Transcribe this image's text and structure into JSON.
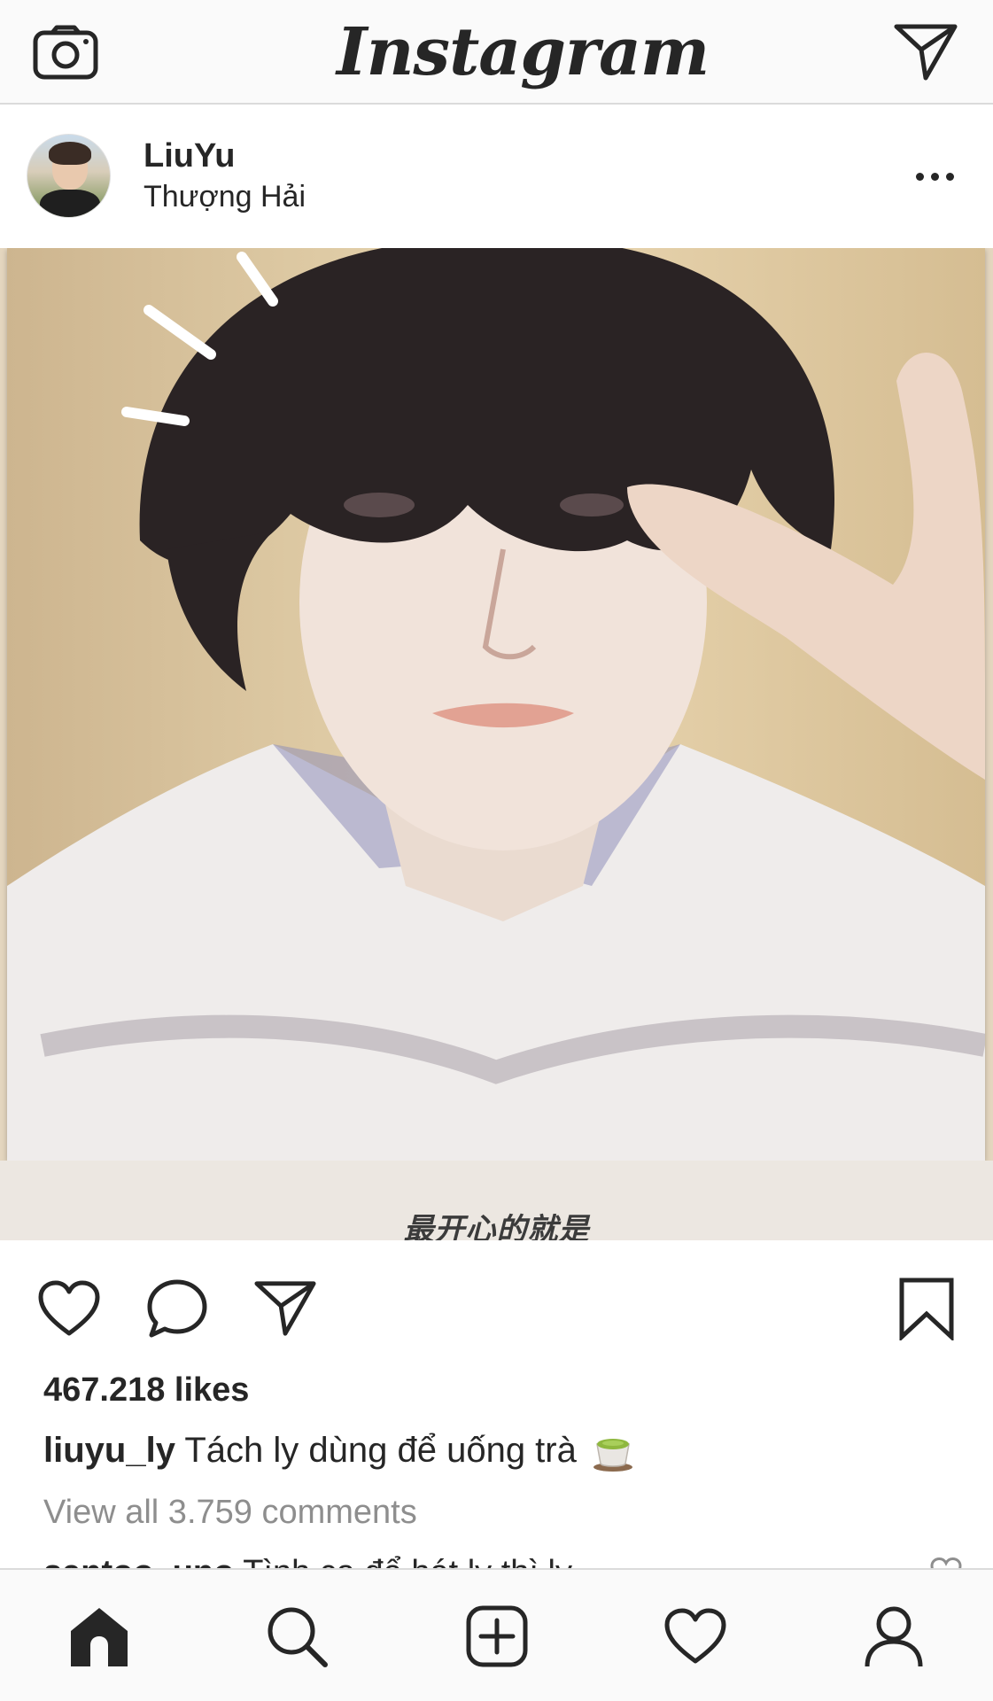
{
  "app": {
    "title": "Instagram"
  },
  "post": {
    "username": "LiuYu",
    "location": "Thượng Hải",
    "photo_subtitle": "最开心的就是",
    "likes": "467.218 likes",
    "caption_user": "liuyu_ly",
    "caption_text": "Tách ly dùng để uống trà",
    "view_comments": "View all 3.759 comments",
    "first_comment_user": "santoo_uno",
    "first_comment_text": "Tình ca để hát ly thì ly"
  },
  "icons": {
    "camera": "camera-icon",
    "direct": "paper-plane-icon",
    "more": "more-dots-icon",
    "like": "heart-icon",
    "comment": "comment-bubble-icon",
    "share": "paper-plane-icon",
    "save": "bookmark-icon",
    "tea": "tea-cup-emoji",
    "home": "home-icon",
    "search": "search-icon",
    "add": "add-post-icon",
    "activity": "heart-icon",
    "profile": "profile-icon"
  },
  "colors": {
    "text": "#262626",
    "muted": "#8e8e8e",
    "bar_bg": "#fafafa",
    "divider": "#dbdbdb"
  }
}
